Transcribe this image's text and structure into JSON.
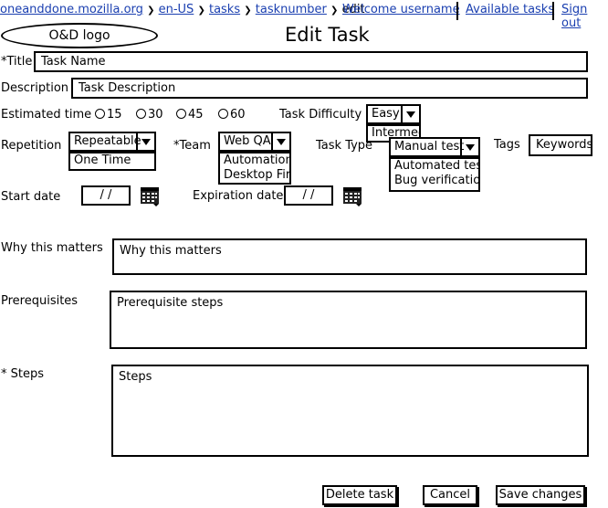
{
  "breadcrumb": {
    "items": [
      "oneanddone.mozilla.org",
      "en-US",
      "tasks",
      "tasknumber"
    ],
    "current": "edit",
    "separator": "❯"
  },
  "header_links": {
    "welcome": "Welcome username",
    "available": "Available tasks",
    "signout": "Sign out"
  },
  "logo": "O&D logo",
  "page_title": "Edit Task",
  "title_field": {
    "label": "*Title",
    "value": "Task Name"
  },
  "description_field": {
    "label": "Description",
    "value": "Task Description"
  },
  "estimated_time": {
    "label": "Estimated time",
    "options": [
      "15",
      "30",
      "45",
      "60"
    ]
  },
  "difficulty": {
    "label": "Task Difficulty",
    "value": "Easy",
    "options": [
      "Intermediate"
    ]
  },
  "repetition": {
    "label": "Repetition",
    "value": "Repeatable",
    "options": [
      "One Time"
    ]
  },
  "team": {
    "label": "*Team",
    "value": "Web QA",
    "options": [
      "Automation",
      "Desktop Firefox"
    ]
  },
  "task_type": {
    "label": "Task Type",
    "value": "Manual test",
    "options": [
      "Automated test",
      "Bug verification"
    ]
  },
  "tags": {
    "label": "Tags",
    "value": "Keywords"
  },
  "start_date": {
    "label": "Start date",
    "value": "/ /"
  },
  "expiration_date": {
    "label": "Expiration date",
    "value": "/ /"
  },
  "why_matters": {
    "label": "Why this matters",
    "value": "Why this matters"
  },
  "prerequisites": {
    "label": "Prerequisites",
    "value": "Prerequisite steps"
  },
  "steps": {
    "label": "* Steps",
    "value": "Steps"
  },
  "buttons": {
    "delete": "Delete task",
    "cancel": "Cancel",
    "save": "Save changes"
  }
}
